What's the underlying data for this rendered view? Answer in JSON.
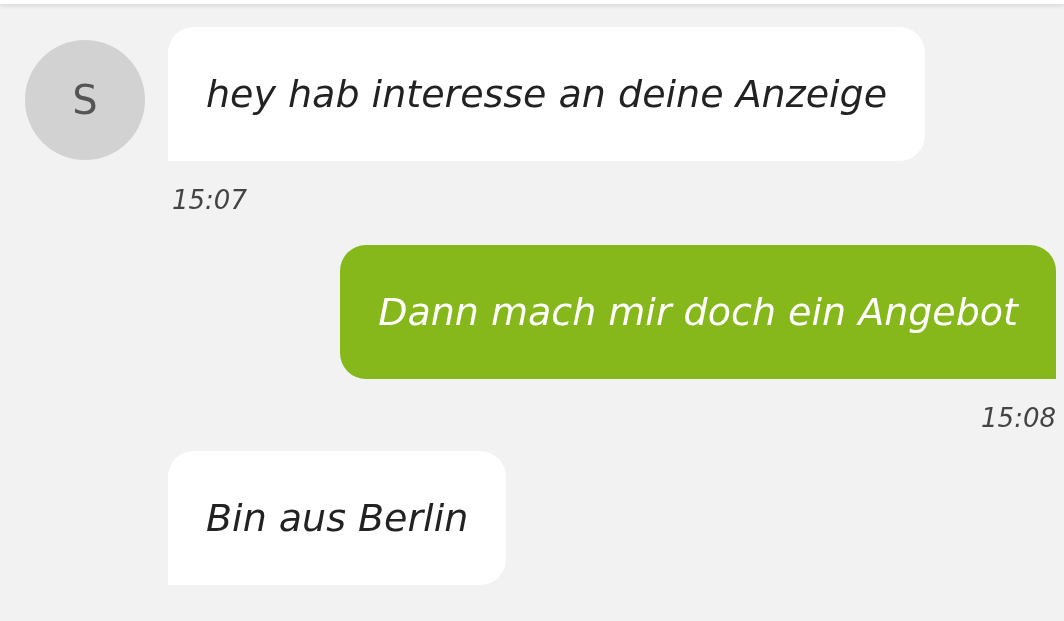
{
  "messages": [
    {
      "kind": "incoming",
      "avatar": "S",
      "text": "hey hab interesse an deine Anzeige",
      "time": "15:07"
    },
    {
      "kind": "outgoing",
      "text": "Dann mach mir doch ein Angebot",
      "time": "15:08"
    },
    {
      "kind": "incoming",
      "text": "Bin aus Berlin"
    }
  ]
}
